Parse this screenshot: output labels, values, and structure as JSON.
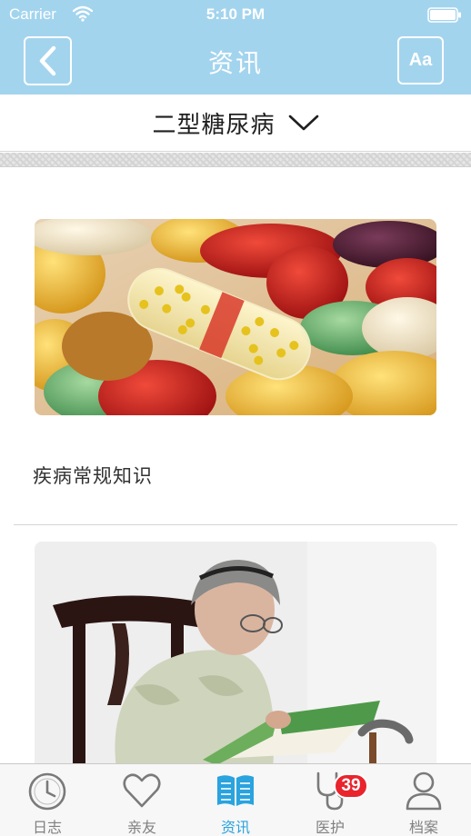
{
  "status_bar": {
    "carrier": "Carrier",
    "time": "5:10 PM"
  },
  "nav": {
    "title": "资讯",
    "back_icon": "chevron-left-icon",
    "font_button": "Aa"
  },
  "category": {
    "label": "二型糖尿病",
    "icon": "chevron-down-icon"
  },
  "articles": [
    {
      "title": "疾病常规知识",
      "image": "colorful-pills-and-capsules-photo"
    },
    {
      "image": "elderly-woman-reading-book-photo"
    }
  ],
  "tabbar": {
    "tabs": [
      {
        "label": "日志",
        "icon": "clock-icon",
        "active": false
      },
      {
        "label": "亲友",
        "icon": "heart-icon",
        "active": false
      },
      {
        "label": "资讯",
        "icon": "open-book-icon",
        "active": true
      },
      {
        "label": "医护",
        "icon": "stethoscope-icon",
        "active": false,
        "badge": "39"
      },
      {
        "label": "档案",
        "icon": "person-icon",
        "active": false
      }
    ]
  },
  "colors": {
    "header_bg": "#a3d4ee",
    "active_tab": "#2aa3df",
    "inactive_tab": "#808080",
    "badge": "#e9242d"
  }
}
